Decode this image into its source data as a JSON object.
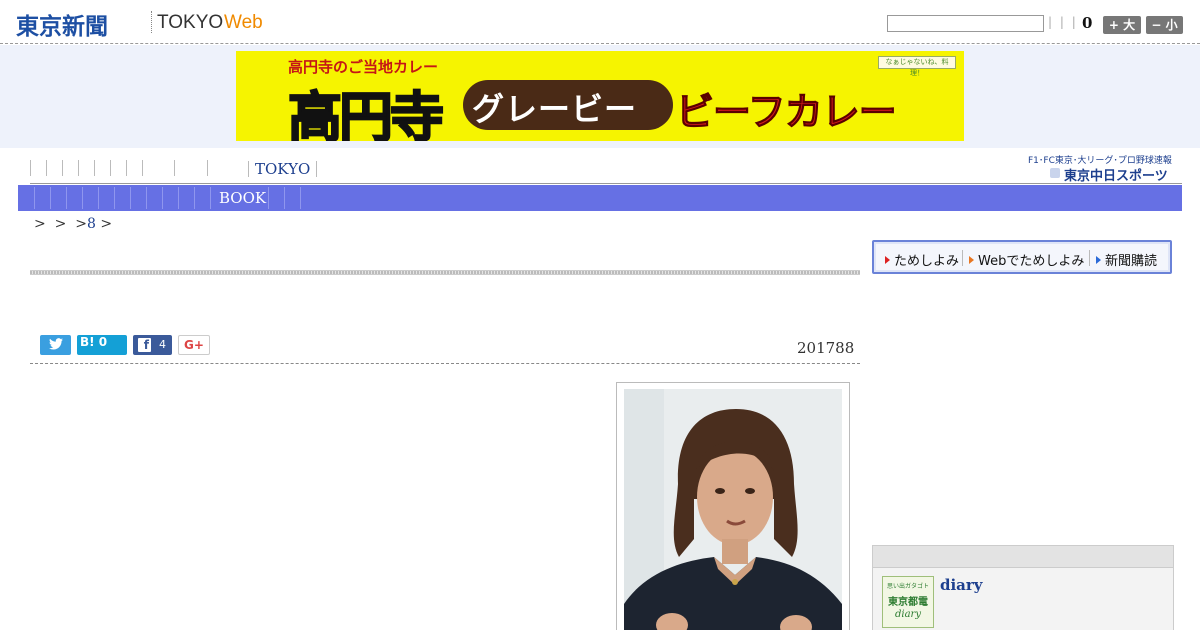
{
  "header": {
    "logo_jp": "東京新聞",
    "logo_tokyo": "TOKYO",
    "logo_web": "Web",
    "search_value": "",
    "search_separators": "| | |",
    "count": "0",
    "font_large": "+ 大",
    "font_small": "− 小"
  },
  "banner": {
    "sub": "高円寺のご当地カレー",
    "koenji": "高円寺",
    "gravy": "グレービー",
    "beef": "ビーフカレー",
    "badge": "なぁじゃないね、料理！"
  },
  "nav": {
    "tokyo": "TOKYO",
    "chunichi_line1": "F1･FC東京･大リーグ･プロ野球速報",
    "chunichi_line2": "東京中日スポーツ"
  },
  "category": {
    "book": "BOOK"
  },
  "breadcrumb": {
    "sep1": ">",
    "sep2": ">",
    "sep3": ">",
    "link": "8",
    "sep4": ">"
  },
  "share": {
    "hatena": "B! 0",
    "facebook_count": "4",
    "gplus": "G+"
  },
  "article": {
    "date": "201788"
  },
  "promo": {
    "tameshi": "ためしよみ",
    "web": "Webでためしよみ",
    "subscribe": "新聞購読"
  },
  "diary": {
    "thumb_line1": "思い出ガタゴト",
    "thumb_line2": "東京都電",
    "thumb_line3": "diary",
    "title": "diary"
  },
  "colors": {
    "brand_blue": "#1d4fa3",
    "web_orange": "#f08a00",
    "category_bar": "#6670e4",
    "promo_border": "#6a82d8"
  }
}
